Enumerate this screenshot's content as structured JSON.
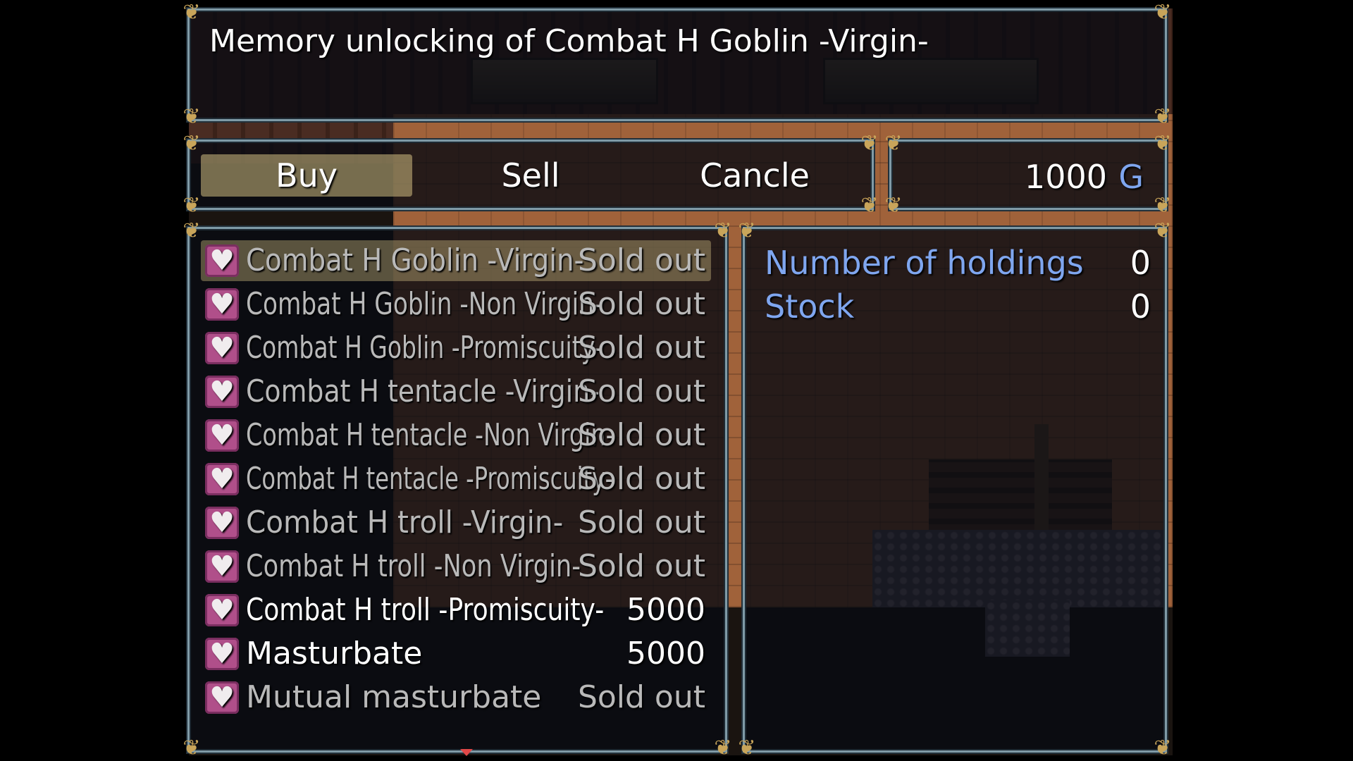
{
  "help": {
    "title": "Memory unlocking of Combat H Goblin -Virgin-"
  },
  "commands": [
    {
      "label": "Buy",
      "selected": true
    },
    {
      "label": "Sell",
      "selected": false
    },
    {
      "label": "Cancle",
      "selected": false
    }
  ],
  "gold": {
    "amount": "1000",
    "unit": "G"
  },
  "items": [
    {
      "name": "Combat H Goblin -Virgin-",
      "price": "Sold out",
      "icon": "heart-icon"
    },
    {
      "name": "Combat H Goblin -Non Virgin-",
      "price": "Sold out",
      "icon": "heart-icon"
    },
    {
      "name": "Combat H Goblin -Promiscuity-",
      "price": "Sold out",
      "icon": "heart-icon"
    },
    {
      "name": "Combat H tentacle -Virgin-",
      "price": "Sold out",
      "icon": "heart-icon"
    },
    {
      "name": "Combat H tentacle -Non Virgin-",
      "price": "Sold out",
      "icon": "heart-icon"
    },
    {
      "name": "Combat H tentacle -Promiscuity-",
      "price": "Sold out",
      "icon": "heart-icon"
    },
    {
      "name": "Combat H troll -Virgin-",
      "price": "Sold out",
      "icon": "heart-icon"
    },
    {
      "name": "Combat H troll -Non Virgin-",
      "price": "Sold out",
      "icon": "heart-icon"
    },
    {
      "name": "Combat H troll -Promiscuity-",
      "price": "5000",
      "icon": "heart-icon"
    },
    {
      "name": "Masturbate",
      "price": "5000",
      "icon": "heart-icon"
    },
    {
      "name": "Mutual masturbate",
      "price": "Sold out",
      "icon": "heart-icon"
    }
  ],
  "status": {
    "holdings_label": "Number of holdings",
    "holdings_value": "0",
    "stock_label": "Stock",
    "stock_value": "0"
  },
  "colors": {
    "system_blue": "#7fa6ef",
    "selection": "#d2be82",
    "heart_bg": "#b04f8a",
    "window_border": "#7f9aa6"
  }
}
